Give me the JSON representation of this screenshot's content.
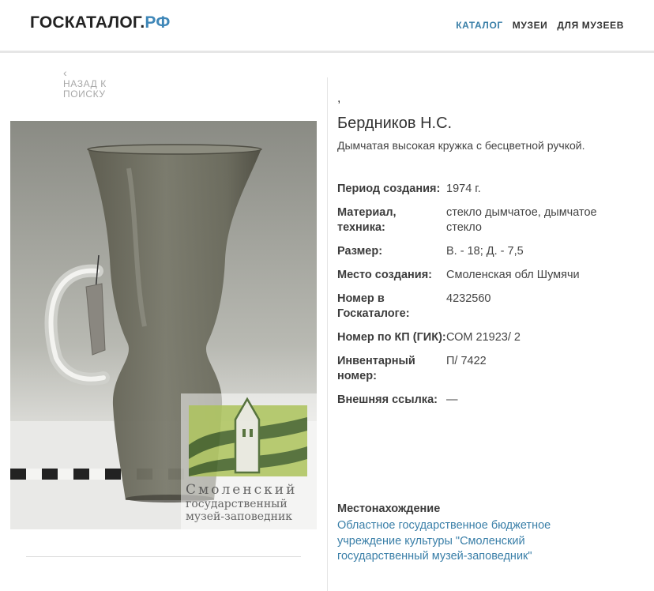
{
  "header": {
    "logo_main": "ГОСКАТАЛОГ.",
    "logo_suffix": "РФ",
    "nav": [
      "КАТАЛОГ",
      "МУЗЕИ",
      "ДЛЯ МУЗЕЕВ"
    ]
  },
  "back": {
    "chevron": "‹",
    "label": "НАЗАД К ПОИСКУ"
  },
  "photo": {
    "watermark_lines": [
      "Смоленский",
      "государственный",
      "музей-заповедник"
    ]
  },
  "item": {
    "comma": ",",
    "author": "Бердников Н.С.",
    "description": "Дымчатая высокая кружка с бесцветной ручкой.",
    "properties": [
      {
        "label": "Период создания:",
        "value": "1974 г."
      },
      {
        "label": "Материал, техника:",
        "value": "стекло дымчатое, дымчатое стекло"
      },
      {
        "label": "Размер:",
        "value": "В. - 18; Д. - 7,5"
      },
      {
        "label": "Место создания:",
        "value": "Смоленская обл Шумячи"
      },
      {
        "label": "Номер в Госкаталоге:",
        "value": "4232560"
      },
      {
        "label": "Номер по КП (ГИК):",
        "value": "СОМ 21923/ 2"
      },
      {
        "label": "Инвентарный номер:",
        "value": "П/ 7422"
      },
      {
        "label": "Внешняя ссылка:",
        "value": "—"
      }
    ],
    "location_label": "Местонахождение",
    "location_value": "Областное государственное бюджетное учреждение культуры \"Смоленский государственный музей-заповедник\""
  },
  "colors": {
    "accent": "#3a7fa8",
    "logo_suffix": "#3f87b8",
    "text": "#333333",
    "muted": "#a8a8a8"
  }
}
